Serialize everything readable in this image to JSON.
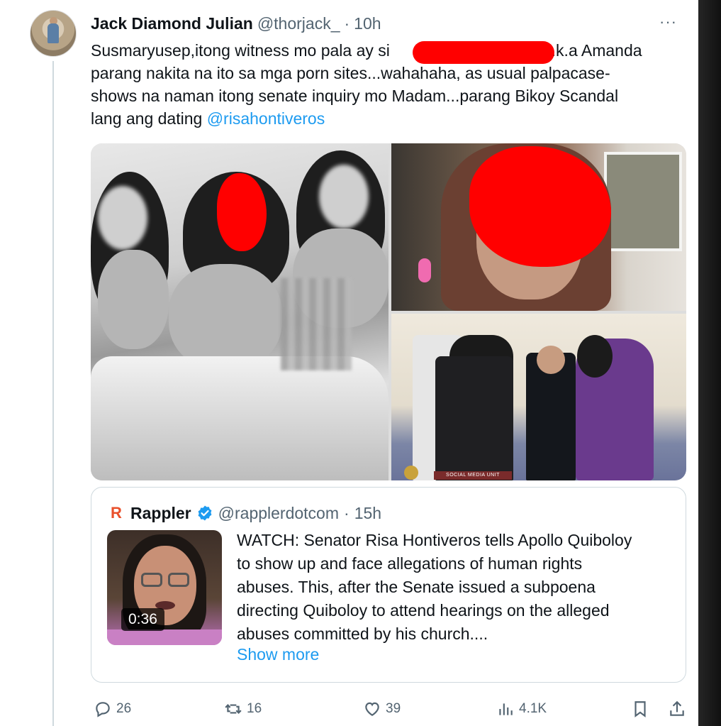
{
  "tweet": {
    "author_name": "Jack Diamond Julian",
    "handle": "@thorjack_",
    "separator": "·",
    "time": "10h",
    "more": "···",
    "text_lines": [
      "Susmaryusep,itong witness mo pala ay si",
      "a.k.a Amanda",
      "parang nakita na ito sa mga porn sites...wahahaha, as usual palpacase-",
      "shows na naman itong senate inquiry mo Madam...parang  Bikoy Scandal",
      "lang ang dating "
    ],
    "mention": "@risahontiveros"
  },
  "media": {
    "badge_text": "SOCIAL MEDIA UNIT"
  },
  "quote": {
    "author_name": "Rappler",
    "logo": "R",
    "verified_icon": "verified-badge-icon",
    "handle": "@rapplerdotcom",
    "separator": "·",
    "time": "15h",
    "video_duration": "0:36",
    "text_lines": [
      "WATCH: Senator Risa Hontiveros tells Apollo Quiboloy",
      "to show up and face allegations of human rights",
      "abuses. This, after the Senate issued a subpoena",
      "directing Quiboloy to attend hearings on the alleged",
      "abuses committed by his church...."
    ],
    "show_more": "Show more"
  },
  "actions": {
    "replies": "26",
    "reposts": "16",
    "likes": "39",
    "views": "4.1K",
    "icons": [
      "reply-icon",
      "repost-icon",
      "like-icon",
      "views-icon",
      "bookmark-icon",
      "share-icon"
    ]
  },
  "colors": {
    "link": "#1d9bf0",
    "secondary_text": "#536471",
    "redaction": "#ff0000",
    "verified": "#1d9bf0"
  }
}
